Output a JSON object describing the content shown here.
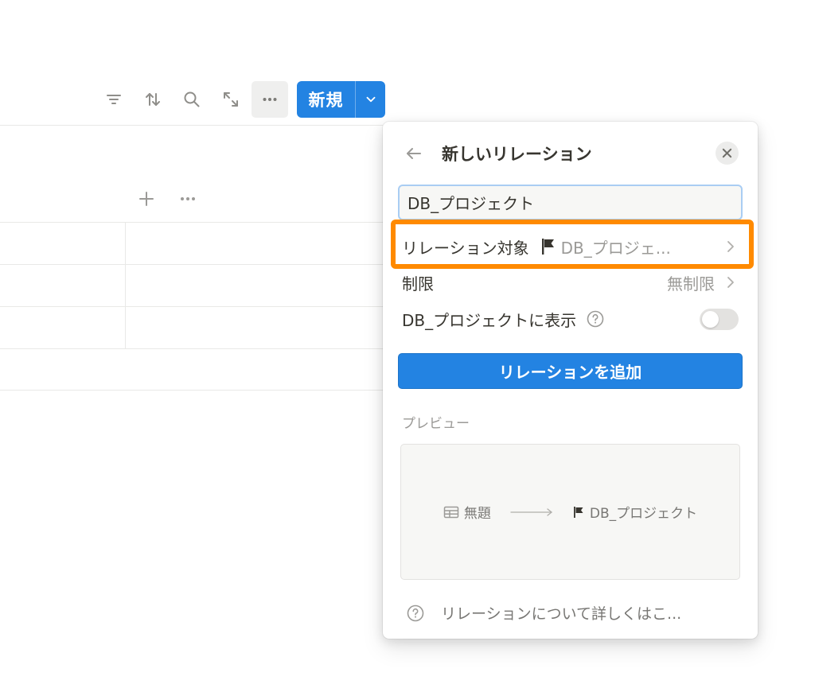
{
  "toolbar": {
    "icons": [
      "filter-icon",
      "sort-icon",
      "search-icon",
      "expand-icon",
      "more-icon"
    ],
    "new_label": "新規"
  },
  "popover": {
    "title": "新しいリレーション",
    "name_value": "DB_プロジェクト",
    "relation_target_label": "リレーション対象",
    "relation_target_value": "DB_プロジェ...",
    "limit_label": "制限",
    "limit_value": "無制限",
    "show_on_label": "DB_プロジェクトに表示",
    "show_on_enabled": false,
    "add_button_label": "リレーションを追加",
    "preview_label": "プレビュー",
    "preview_source": "無題",
    "preview_target": "DB_プロジェクト",
    "learn_more": "リレーションについて詳しくはこ..."
  },
  "colors": {
    "accent": "#2383e2",
    "highlight": "#ff8a00"
  }
}
